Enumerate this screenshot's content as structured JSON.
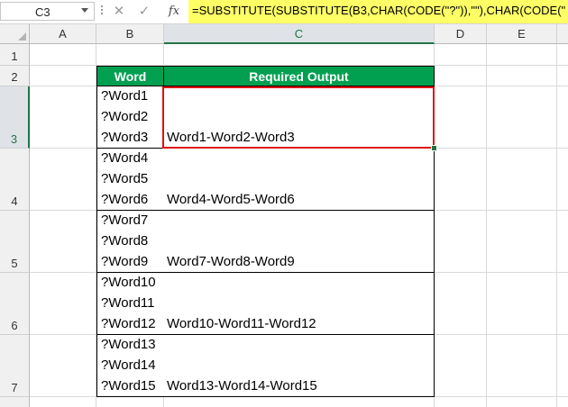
{
  "formula_bar": {
    "name_box": "C3",
    "fx_icon": "fx",
    "formula": "=SUBSTITUTE(SUBSTITUTE(B3,CHAR(CODE(\"?\")),\"\"),CHAR(CODE(\""
  },
  "columns": [
    "A",
    "B",
    "C",
    "D",
    "E"
  ],
  "row_numbers": [
    "1",
    "2",
    "3",
    "4",
    "5",
    "6",
    "7"
  ],
  "table": {
    "headers": [
      "Word",
      "Required Output"
    ],
    "rows": [
      {
        "row": "3",
        "words": [
          "?Word1",
          "?Word2",
          "?Word3"
        ],
        "output": "Word1-Word2-Word3"
      },
      {
        "row": "4",
        "words": [
          "?Word4",
          "?Word5",
          "?Word6"
        ],
        "output": "Word4-Word5-Word6"
      },
      {
        "row": "5",
        "words": [
          "?Word7",
          "?Word8",
          "?Word9"
        ],
        "output": "Word7-Word8-Word9"
      },
      {
        "row": "6",
        "words": [
          "?Word10",
          "?Word11",
          "?Word12"
        ],
        "output": "Word10-Word11-Word12"
      },
      {
        "row": "7",
        "words": [
          "?Word13",
          "?Word14",
          "?Word15"
        ],
        "output": "Word13-Word14-Word15"
      }
    ]
  },
  "colors": {
    "table_header_bg": "#00a050",
    "selection_border": "#e01010",
    "formula_highlight": "#ffff66"
  }
}
